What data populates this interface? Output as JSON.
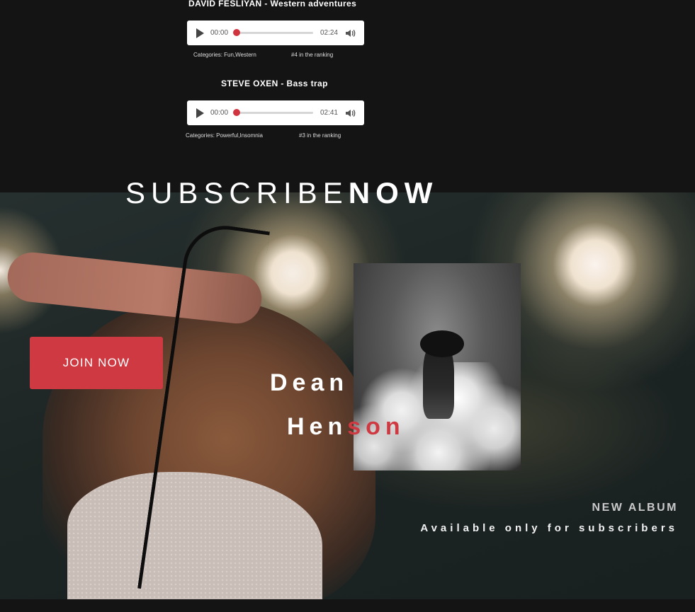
{
  "playlist": {
    "tracks": [
      {
        "title": "DAVID FESLIYAN - Western adventures",
        "current_time": "00:00",
        "duration": "02:24",
        "progress": 0,
        "categories": "Categories: Fun,Western",
        "ranking": "#4 in the ranking"
      },
      {
        "title": "STEVE OXEN - Bass trap",
        "current_time": "00:00",
        "duration": "02:41",
        "progress": 0,
        "categories": "Categories: Powerful,Insomnia",
        "ranking": "#3 in the ranking"
      }
    ]
  },
  "subscribe": {
    "light": "SUBSCRIBE",
    "bold": "NOW"
  },
  "join_button": "JOIN NOW",
  "artist": {
    "first": "Dean",
    "last_plain": "Hen",
    "last_accent": "son"
  },
  "album": {
    "label": "NEW ALBUM",
    "tagline": "Available only for subscribers"
  },
  "colors": {
    "accent": "#cf3a42",
    "dark_bg": "#141414",
    "player_bg": "#ffffff",
    "progress_knob": "#d0343f"
  },
  "icons": [
    "play-icon",
    "volume-icon"
  ]
}
